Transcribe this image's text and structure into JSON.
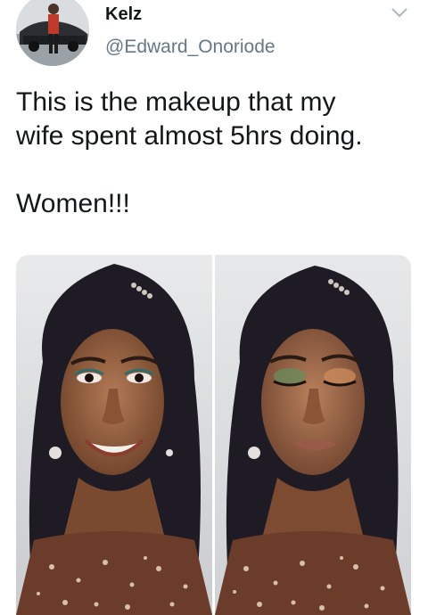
{
  "tweet": {
    "display_name": "Kelz",
    "handle": "@Edward_Onoriode",
    "text_lines": [
      "This is the makeup that my",
      "wife spent almost 5hrs doing.",
      "Women!!!"
    ]
  },
  "icons": {
    "caret": "chevron-down-icon"
  },
  "media": {
    "photos": [
      {
        "name": "selfie-smiling"
      },
      {
        "name": "selfie-eyes-closed"
      }
    ]
  },
  "colors": {
    "text": "#14171a",
    "secondary_text": "#657786",
    "background": "#ffffff"
  }
}
